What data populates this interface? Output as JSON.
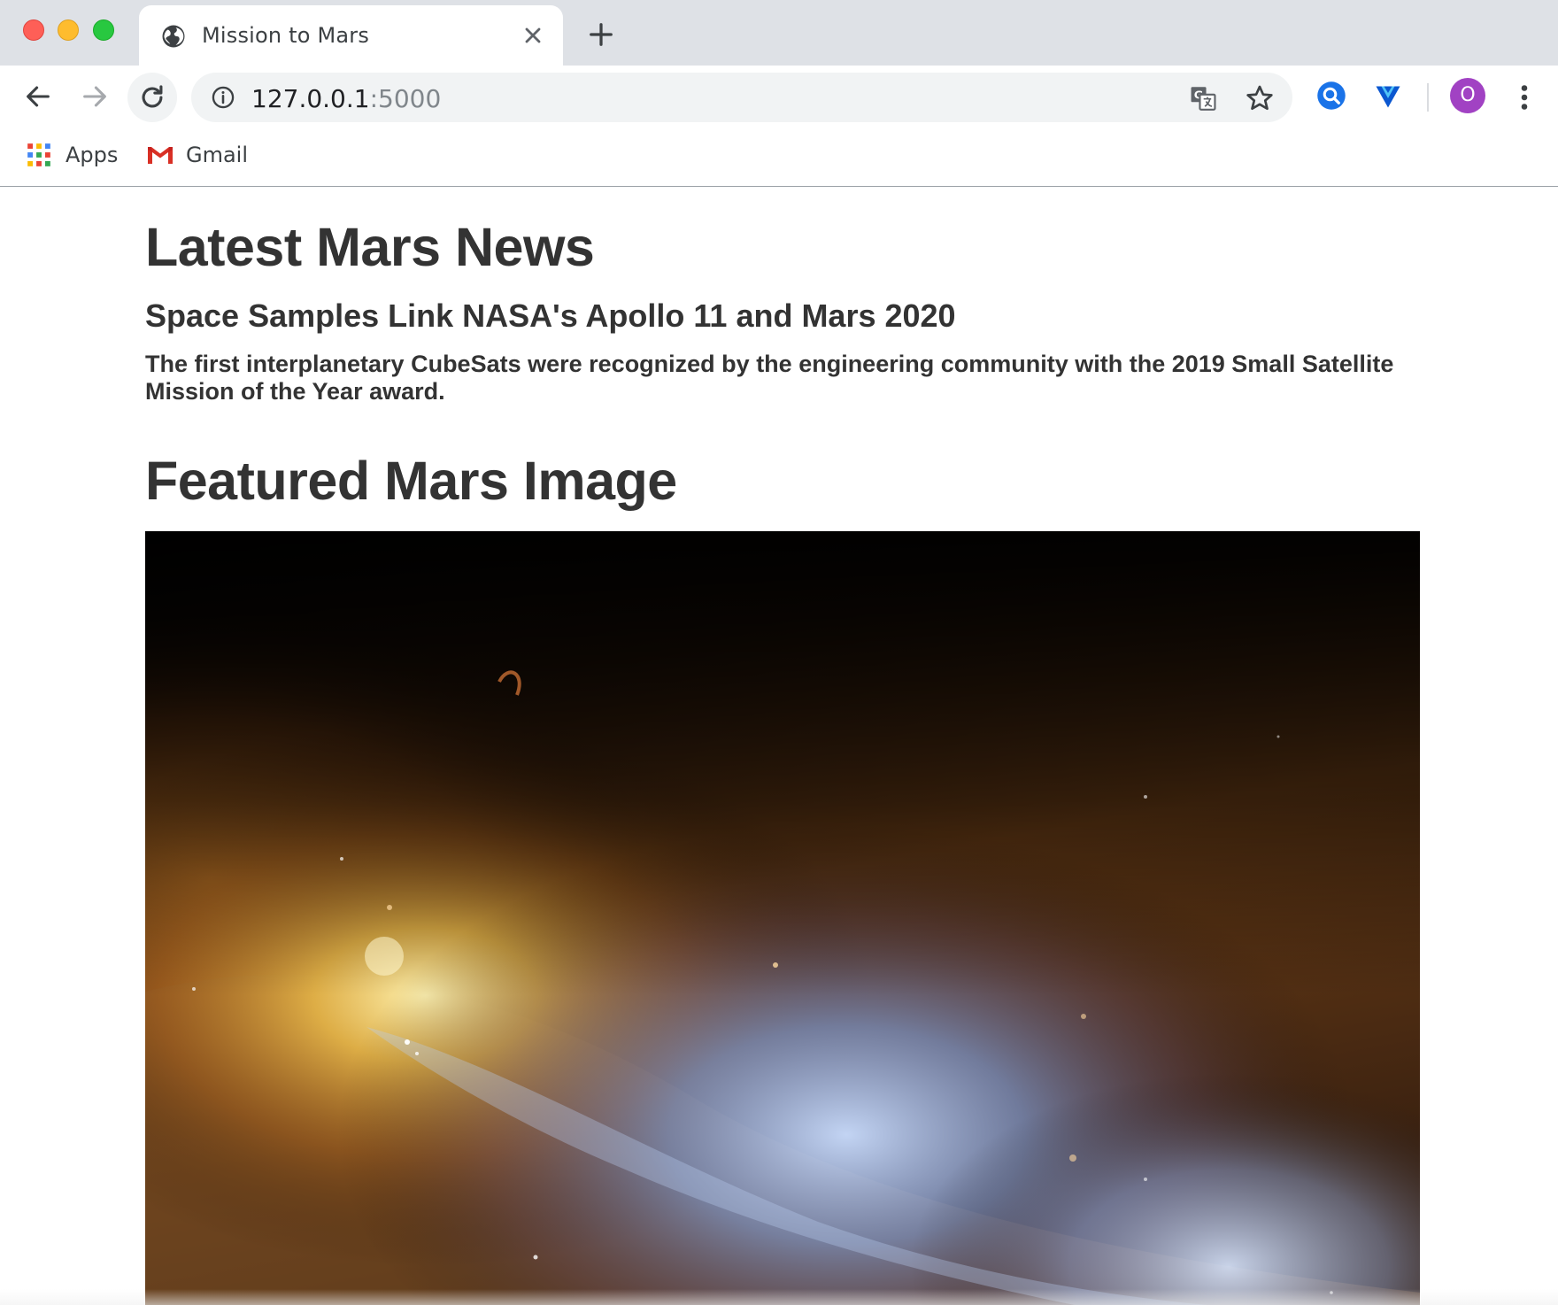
{
  "browser": {
    "tab": {
      "title": "Mission to Mars",
      "favicon": "globe-icon"
    },
    "address_bar": {
      "host": "127.0.0.1",
      "port": ":5000"
    },
    "profile_initial": "O",
    "bookmarks": [
      {
        "label": "Apps",
        "icon": "apps-grid-icon"
      },
      {
        "label": "Gmail",
        "icon": "gmail-icon"
      }
    ],
    "extensions": [
      "search-extension-icon",
      "vpn-extension-icon"
    ],
    "colors": {
      "tabstrip": "#dee1e6",
      "profile": "#a142c3"
    }
  },
  "page": {
    "news": {
      "section_title": "Latest Mars News",
      "headline": "Space Samples Link NASA's Apollo 11 and Mars 2020",
      "teaser": "The first interplanetary CubeSats were recognized by the engineering community with the 2019 Small Satellite Mission of the Year award."
    },
    "featured": {
      "section_title": "Featured Mars Image",
      "image": "nebula-space-photo"
    }
  }
}
